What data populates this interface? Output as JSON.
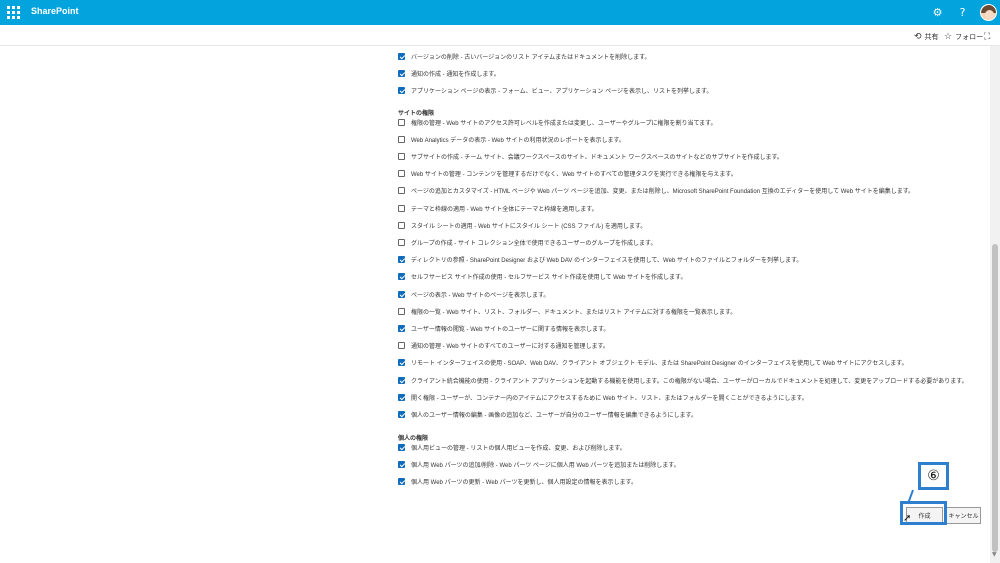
{
  "topbar": {
    "app_title": "SharePoint",
    "settings_icon": "gear-icon",
    "help_label": "?",
    "avatar_icon": "avatar"
  },
  "actions": {
    "share_label": "共有",
    "follow_label": "フォロー",
    "fullscreen_icon": "expand-icon"
  },
  "lists": [
    {
      "checked": true,
      "text": "バージョンの削除 - 古いバージョンのリスト アイテムまたはドキュメントを削除します。"
    },
    {
      "checked": true,
      "text": "通知の作成 - 通知を作成します。"
    },
    {
      "checked": true,
      "text": "アプリケーション ページの表示 - フォーム、ビュー、アプリケーション ページを表示し、リストを列挙します。"
    }
  ],
  "site_section_title": "サイトの権限",
  "site_permissions": [
    {
      "checked": false,
      "text": "権限の管理 - Web サイトのアクセス許可レベルを作成または変更し、ユーザーやグループに権限を割り当てます。"
    },
    {
      "checked": false,
      "text": "Web Analytics データの表示 - Web サイトの利用状況のレポートを表示します。"
    },
    {
      "checked": false,
      "text": "サブサイトの作成 - チーム サイト、会議ワークスペースのサイト、ドキュメント ワークスペースのサイトなどのサブサイトを作成します。"
    },
    {
      "checked": false,
      "text": "Web サイトの管理 - コンテンツを管理するだけでなく、Web サイトのすべての管理タスクを実行できる権限を与えます。"
    },
    {
      "checked": false,
      "text": "ページの追加とカスタマイズ - HTML ページや Web パーツ ページを追加、変更、または削除し、Microsoft SharePoint Foundation 互換のエディターを使用して Web サイトを編集します。"
    },
    {
      "checked": false,
      "text": "テーマと枠線の適用 - Web サイト全体にテーマと枠線を適用します。"
    },
    {
      "checked": false,
      "text": "スタイル シートの適用 - Web サイトにスタイル シート (CSS ファイル) を適用します。"
    },
    {
      "checked": false,
      "text": "グループの作成 - サイト コレクション全体で使用できるユーザーのグループを作成します。"
    },
    {
      "checked": true,
      "text": "ディレクトリの参照 - SharePoint Designer および Web DAV のインターフェイスを使用して、Web サイトのファイルとフォルダーを列挙します。"
    },
    {
      "checked": true,
      "text": "セルフサービス サイト作成の使用 - セルフサービス サイト作成を使用して Web サイトを作成します。"
    },
    {
      "checked": true,
      "text": "ページの表示 - Web サイトのページを表示します。"
    },
    {
      "checked": false,
      "text": "権限の一覧 - Web サイト、リスト、フォルダー、ドキュメント、またはリスト アイテムに対する権限を一覧表示します。"
    },
    {
      "checked": true,
      "text": "ユーザー情報の閲覧 - Web サイトのユーザーに関する情報を表示します。"
    },
    {
      "checked": false,
      "text": "通知の管理 - Web サイトのすべてのユーザーに対する通知を管理します。"
    },
    {
      "checked": true,
      "text": "リモート インターフェイスの使用 - SOAP、Web DAV、クライアント オブジェクト モデル、または SharePoint Designer のインターフェイスを使用して Web サイトにアクセスします。"
    },
    {
      "checked": true,
      "text": "クライアント統合機能の使用 - クライアント アプリケーションを起動する機能を使用します。この権限がない場合、ユーザーがローカルでドキュメントを処理して、変更をアップロードする必要があります。"
    },
    {
      "checked": true,
      "text": "開く権限 - ユーザーが、コンテナー内のアイテムにアクセスするために Web サイト、リスト、またはフォルダーを開くことができるようにします。"
    },
    {
      "checked": true,
      "text": "個人のユーザー情報の編集 - 画像の追加など、ユーザーが自分のユーザー情報を編集できるようにします。"
    }
  ],
  "personal_section_title": "個人の権限",
  "personal_permissions": [
    {
      "checked": true,
      "text": "個人用ビューの管理 - リストの個人用ビューを作成、変更、および削除します。"
    },
    {
      "checked": true,
      "text": "個人用 Web パーツの追加/削除 - Web パーツ ページに個人用 Web パーツを追加または削除します。"
    },
    {
      "checked": true,
      "text": "個人用 Web パーツの更新 - Web パーツを更新し、個人用設定の情報を表示します。"
    }
  ],
  "buttons": {
    "create_label": "作成",
    "cancel_label": "キャンセル"
  },
  "callout": {
    "label": "⑥"
  },
  "colors": {
    "topbar": "#03a4dd",
    "checkbox_on": "#0f6cbd",
    "highlight": "#2f7fcf"
  }
}
